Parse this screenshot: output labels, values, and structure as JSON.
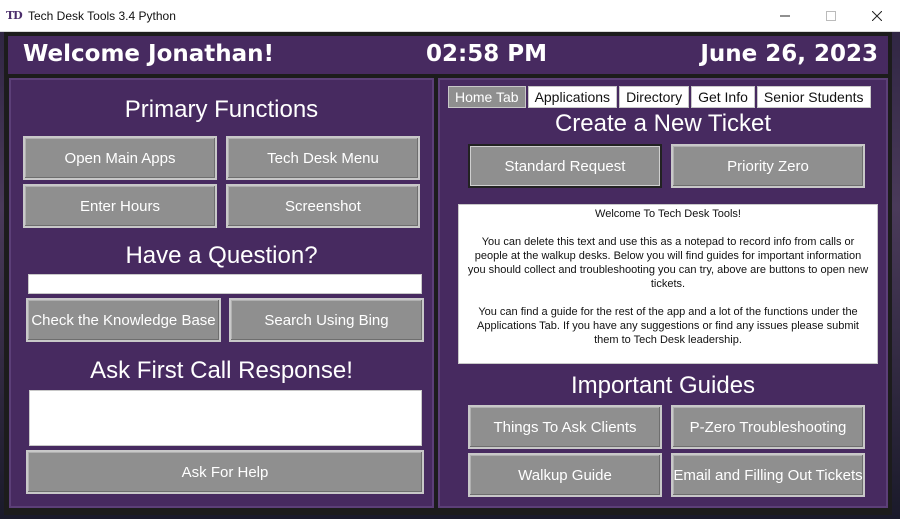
{
  "titlebar": {
    "icon_text": "TD",
    "title": "Tech Desk Tools 3.4 Python"
  },
  "header": {
    "welcome": "Welcome Jonathan!",
    "time": "02:58 PM",
    "date": "June 26, 2023"
  },
  "left": {
    "primary_title": "Primary Functions",
    "open_main_apps": "Open Main Apps",
    "tech_desk_menu": "Tech Desk Menu",
    "enter_hours": "Enter Hours",
    "screenshot": "Screenshot",
    "question_title": "Have a Question?",
    "question_value": "",
    "check_kb": "Check the Knowledge Base",
    "search_bing": "Search Using Bing",
    "fcr_title": "Ask First Call Response!",
    "fcr_value": "",
    "ask_help": "Ask For Help"
  },
  "right": {
    "tabs": [
      "Home Tab",
      "Applications",
      "Directory",
      "Get Info",
      "Senior Students"
    ],
    "active_tab": "Home Tab",
    "ticket_title": "Create a New Ticket",
    "standard_request": "Standard Request",
    "priority_zero": "Priority Zero",
    "notepad_text": "Welcome To Tech Desk Tools!\n\nYou can delete this text and use this as a notepad to record info from calls or people at the walkup desks. Below you will find guides for important information you should collect and troubleshooting you can try, above are buttons to open new tickets.\n\nYou can find a guide for the rest of the app and a lot of the functions under the Applications Tab. If you have any suggestions or find any issues please submit them to Tech Desk leadership.",
    "guides_title": "Important Guides",
    "things_to_ask": "Things To Ask Clients",
    "pzero_troubleshooting": "P-Zero Troubleshooting",
    "walkup_guide": "Walkup Guide",
    "email_tickets": "Email and Filling Out Tickets"
  }
}
